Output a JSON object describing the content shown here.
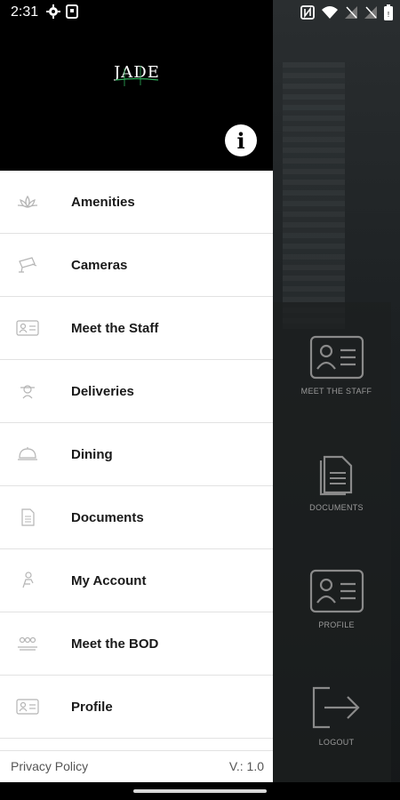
{
  "status": {
    "time": "2:31",
    "icons_left": [
      "settings-icon",
      "screen-record-icon"
    ],
    "icons_right": [
      "nfc-icon",
      "wifi-icon",
      "no-signal-icon",
      "no-signal-icon",
      "battery-icon"
    ]
  },
  "brand": {
    "logo_text": "JADE",
    "accent_color": "#2fae5a"
  },
  "info_button": {
    "glyph": "i"
  },
  "menu": [
    {
      "label": "Amenities",
      "icon": "lotus-icon"
    },
    {
      "label": "Cameras",
      "icon": "camera-icon"
    },
    {
      "label": "Meet the Staff",
      "icon": "id-card-icon"
    },
    {
      "label": "Deliveries",
      "icon": "delivery-icon"
    },
    {
      "label": "Dining",
      "icon": "cloche-icon"
    },
    {
      "label": "Documents",
      "icon": "document-icon"
    },
    {
      "label": "My Account",
      "icon": "account-icon"
    },
    {
      "label": "Meet the BOD",
      "icon": "group-icon"
    },
    {
      "label": "Profile",
      "icon": "profile-card-icon"
    }
  ],
  "footer": {
    "privacy": "Privacy Policy",
    "version": "V.: 1.0"
  },
  "background_menu": [
    {
      "label": "MEET THE STAFF",
      "icon": "id-card-icon"
    },
    {
      "label": "DOCUMENTS",
      "icon": "document-icon"
    },
    {
      "label": "PROFILE",
      "icon": "id-card-icon"
    },
    {
      "label": "LOGOUT",
      "icon": "logout-icon"
    }
  ],
  "colors": {
    "drawer_bg": "#ffffff",
    "header_bg": "#000000",
    "divider": "#e2e2e2"
  }
}
